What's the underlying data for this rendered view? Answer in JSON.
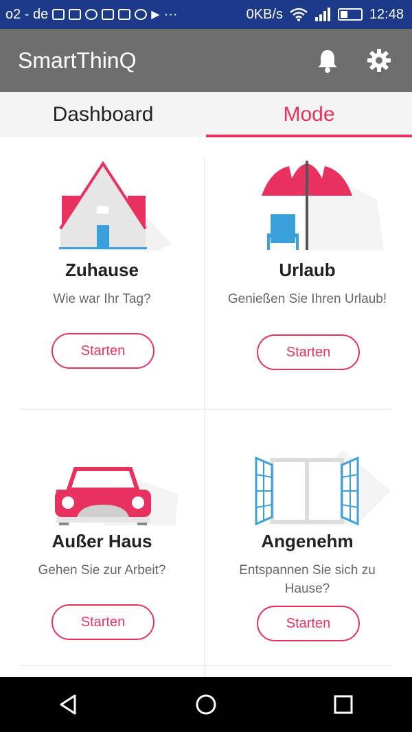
{
  "status_bar": {
    "carrier": "o2 - de",
    "net_speed": "0KB/s",
    "time": "12:48"
  },
  "app": {
    "title": "SmartThinQ"
  },
  "tabs": [
    {
      "label": "Dashboard"
    },
    {
      "label": "Mode"
    }
  ],
  "modes": [
    {
      "name": "Zuhause",
      "desc": "Wie war Ihr Tag?",
      "button": "Starten"
    },
    {
      "name": "Urlaub",
      "desc": "Genießen Sie Ihren Urlaub!",
      "button": "Starten"
    },
    {
      "name": "Außer Haus",
      "desc": "Gehen Sie zur Arbeit?",
      "button": "Starten"
    },
    {
      "name": "Angenehm",
      "desc": "Entspannen Sie sich zu Hause?",
      "button": "Starten"
    }
  ],
  "colors": {
    "accent": "#e8315f",
    "appbar": "#6e6e6e",
    "statusbar": "#1d3a8a"
  }
}
